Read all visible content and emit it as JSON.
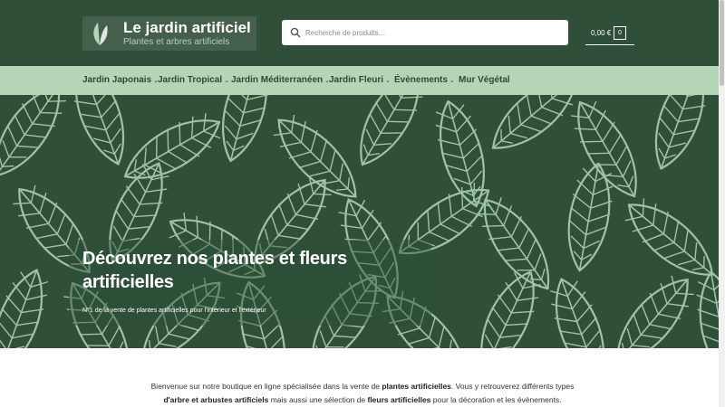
{
  "brand": {
    "title": "Le jardin artificiel",
    "subtitle": "Plantes et arbres artificiels",
    "logo_icon": "leaf-icon"
  },
  "search": {
    "placeholder": "Recherche de produits…",
    "icon": "search-icon"
  },
  "cart": {
    "amount": "0,00 €",
    "count": "0"
  },
  "nav": {
    "items": [
      {
        "label": "Jardin Japonais",
        "has_dropdown": true
      },
      {
        "label": "Jardin Tropical",
        "has_dropdown": true
      },
      {
        "label": "Jardin Méditerranéen",
        "has_dropdown": true
      },
      {
        "label": "Jardin Fleuri",
        "has_dropdown": true
      },
      {
        "label": "Évènements",
        "has_dropdown": true
      },
      {
        "label": "Mur Végétal",
        "has_dropdown": false
      }
    ],
    "chevron": "⌄"
  },
  "hero": {
    "title": "Découvrez nos plantes et fleurs artificielles",
    "subtitle": "N°1 de la vente de plantes artificielles pour l'intérieur et l'extérieur"
  },
  "intro": {
    "line1_a": "Bienvenue sur notre boutique en ligne spécialisée dans la vente de ",
    "line1_b": "plantes artificielles",
    "line1_c": ". Vous y retrouverez différents types",
    "line2_a": "d'arbre et arbustes artificiels",
    "line2_b": " mais aussi une sélection de ",
    "line2_c": "fleurs artificielles",
    "line2_d": " pour la décoration et les évènements."
  },
  "colors": {
    "header_bg": "#2f4f38",
    "nav_bg": "#b5d5b7",
    "leaf_line": "#9fc3a4",
    "text_dark": "#2e4a34"
  }
}
